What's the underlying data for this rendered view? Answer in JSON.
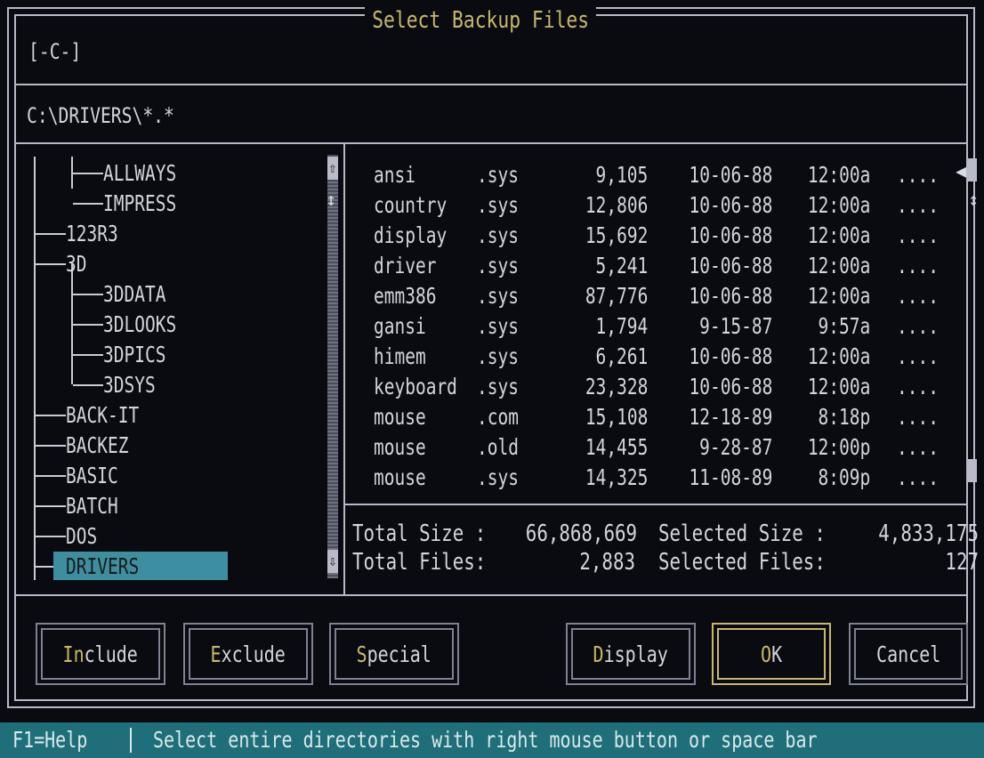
{
  "dialog": {
    "title": "Select Backup Files",
    "drive": "[-C-]",
    "path": "C:\\DRIVERS\\*.*"
  },
  "tree": {
    "items": [
      {
        "label": "ALLWAYS"
      },
      {
        "label": "IMPRESS"
      },
      {
        "label": "123R3"
      },
      {
        "label": "3D"
      },
      {
        "label": "3DDATA"
      },
      {
        "label": "3DLOOKS"
      },
      {
        "label": "3DPICS"
      },
      {
        "label": "3DSYS"
      },
      {
        "label": "BACK-IT"
      },
      {
        "label": "BACKEZ"
      },
      {
        "label": "BASIC"
      },
      {
        "label": "BATCH"
      },
      {
        "label": "DOS"
      },
      {
        "label": "DRIVERS"
      }
    ]
  },
  "files": {
    "rows": [
      {
        "name": "ansi",
        "ext": ".sys",
        "size": "9,105",
        "date": "10-06-88",
        "time": "12:00a",
        "attr": "...."
      },
      {
        "name": "country",
        "ext": ".sys",
        "size": "12,806",
        "date": "10-06-88",
        "time": "12:00a",
        "attr": "...."
      },
      {
        "name": "display",
        "ext": ".sys",
        "size": "15,692",
        "date": "10-06-88",
        "time": "12:00a",
        "attr": "...."
      },
      {
        "name": "driver",
        "ext": ".sys",
        "size": "5,241",
        "date": "10-06-88",
        "time": "12:00a",
        "attr": "...."
      },
      {
        "name": "emm386",
        "ext": ".sys",
        "size": "87,776",
        "date": "10-06-88",
        "time": "12:00a",
        "attr": "...."
      },
      {
        "name": "gansi",
        "ext": ".sys",
        "size": "1,794",
        "date": "9-15-87",
        "time": "9:57a",
        "attr": "...."
      },
      {
        "name": "himem",
        "ext": ".sys",
        "size": "6,261",
        "date": "10-06-88",
        "time": "12:00a",
        "attr": "...."
      },
      {
        "name": "keyboard",
        "ext": ".sys",
        "size": "23,328",
        "date": "10-06-88",
        "time": "12:00a",
        "attr": "...."
      },
      {
        "name": "mouse",
        "ext": ".com",
        "size": "15,108",
        "date": "12-18-89",
        "time": "8:18p",
        "attr": "...."
      },
      {
        "name": "mouse",
        "ext": ".old",
        "size": "14,455",
        "date": "9-28-87",
        "time": "12:00p",
        "attr": "...."
      },
      {
        "name": "mouse",
        "ext": ".sys",
        "size": "14,325",
        "date": "11-08-89",
        "time": "8:09p",
        "attr": "...."
      }
    ]
  },
  "totals": {
    "total_size_label": "Total Size :",
    "total_size": "66,868,669",
    "selected_size_label": "Selected Size :",
    "selected_size": "4,833,175",
    "total_files_label": "Total Files:",
    "total_files": "2,883",
    "selected_files_label": "Selected Files:",
    "selected_files": "127"
  },
  "buttons": {
    "include": {
      "hot": "In",
      "rest": "clude"
    },
    "exclude": {
      "hot": "E",
      "rest": "xclude"
    },
    "special": {
      "hot": "S",
      "rest": "pecial"
    },
    "display": {
      "hot": "D",
      "rest": "isplay"
    },
    "ok": {
      "hot": "O",
      "rest": "K"
    },
    "cancel": {
      "hot": "",
      "rest": "Cancel"
    }
  },
  "status": {
    "help": "F1=Help",
    "message": "Select entire directories with right mouse button or space bar"
  },
  "colors": {
    "background": "#0a0b10",
    "frame": "#b6b9c8",
    "text": "#d2d4de",
    "title": "#c9b86a",
    "selection": "#3d8fa0",
    "statusbar": "#1f6f7a"
  }
}
